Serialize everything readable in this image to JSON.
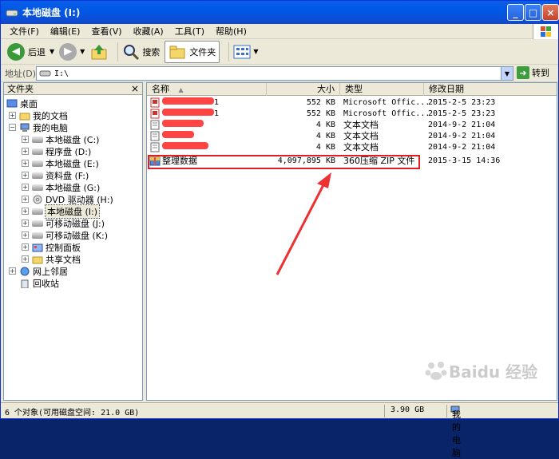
{
  "window": {
    "title": "本地磁盘 (I:)"
  },
  "menu": [
    "文件(F)",
    "编辑(E)",
    "查看(V)",
    "收藏(A)",
    "工具(T)",
    "帮助(H)"
  ],
  "toolbar": {
    "back": "后退",
    "search": "搜索",
    "folders": "文件夹"
  },
  "address": {
    "label": "地址(D)",
    "value": "I:\\",
    "go": "转到"
  },
  "leftpane": {
    "title": "文件夹",
    "close": "×"
  },
  "tree": [
    {
      "label": "桌面",
      "level": 0
    },
    {
      "label": "我的文档",
      "level": 1
    },
    {
      "label": "我的电脑",
      "level": 1
    },
    {
      "label": "本地磁盘 (C:)",
      "level": 2
    },
    {
      "label": "程序盘 (D:)",
      "level": 2
    },
    {
      "label": "本地磁盘 (E:)",
      "level": 2
    },
    {
      "label": "资料盘 (F:)",
      "level": 2
    },
    {
      "label": "本地磁盘 (G:)",
      "level": 2
    },
    {
      "label": "DVD 驱动器 (H:)",
      "level": 2
    },
    {
      "label": "本地磁盘 (I:)",
      "level": 2
    },
    {
      "label": "可移动磁盘 (J:)",
      "level": 2
    },
    {
      "label": "可移动磁盘 (K:)",
      "level": 2
    },
    {
      "label": "控制面板",
      "level": 2
    },
    {
      "label": "共享文档",
      "level": 2
    },
    {
      "label": "网上邻居",
      "level": 1
    },
    {
      "label": "回收站",
      "level": 1
    }
  ],
  "columns": {
    "name": "名称",
    "size": "大小",
    "type": "类型",
    "modified": "修改日期"
  },
  "files": [
    {
      "name": "1",
      "size": "552 KB",
      "type": "Microsoft Offic...",
      "date": "2015-2-5 23:23"
    },
    {
      "name": "1",
      "size": "552 KB",
      "type": "Microsoft Offic...",
      "date": "2015-2-5 23:23"
    },
    {
      "name": "",
      "size": "4 KB",
      "type": "文本文档",
      "date": "2014-9-2 21:04"
    },
    {
      "name": "",
      "size": "4 KB",
      "type": "文本文档",
      "date": "2014-9-2 21:04"
    },
    {
      "name": "",
      "size": "4 KB",
      "type": "文本文档",
      "date": "2014-9-2 21:04"
    },
    {
      "name": "整理数据",
      "size": "4,097,895 KB",
      "type": "360压缩 ZIP 文件",
      "date": "2015-3-15 14:36"
    }
  ],
  "status": {
    "objects": "6 个对象(可用磁盘空间: 21.0 GB)",
    "size": "3.90 GB",
    "location": "我的电脑"
  },
  "watermark": "Baidu 经验"
}
